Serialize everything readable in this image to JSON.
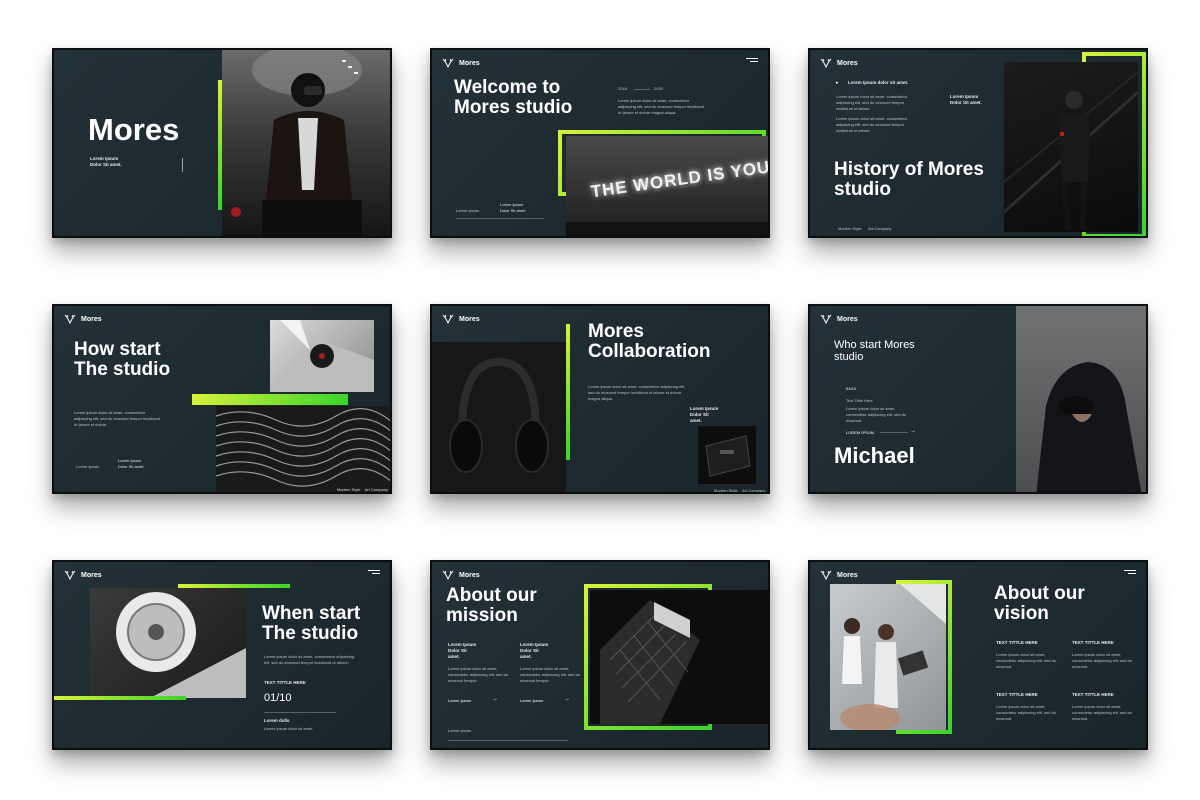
{
  "colors": {
    "accent_yellow": "#d8f23a",
    "accent_green": "#39d42a",
    "slide_bg": "#213036",
    "page_bg": "#ffffff"
  },
  "icons": {
    "brand": "deer-antler-logo-icon",
    "menu": "hamburger-menu-icon",
    "arrow": "arrow-right-icon"
  },
  "brand_name": "Mores",
  "slide1": {
    "title": "Mores",
    "sub": "Lorem Ipsum Dolor Sit amet."
  },
  "slide2": {
    "title": "Welcome to Mores studio",
    "year_start": "2018",
    "year_end": "2020",
    "body": "Lorem ipsum dolor sit amet, consectetur adipiscing elit, sed do eiusmod tempor incididunt ut labore et dolore magna aliqua.",
    "footer_left": "Lorem Ipsum",
    "footer_right": "Lorem Ipsum Dolor Sit amet.",
    "neon_sign": "THE WORLD IS YOURS"
  },
  "slide3": {
    "lead": "Lorem Ipsum dolor sit amet.",
    "body": "Lorem ipsum dolor sit amet, consectetur adipiscing elit, sed do eiusmod tempor incididunt ut labore.",
    "side_note": "Lorem Ipsum Dolor Sit amet.",
    "title": "History of Mores studio",
    "footer_left": "Modern Style",
    "footer_right": "Art Company"
  },
  "slide4": {
    "title": "How start The studio",
    "body": "Lorem ipsum dolor sit amet, consectetur adipiscing elit, sed do eiusmod tempor incididunt ut labore et dolore.",
    "footer_left": "Lorem Ipsum",
    "footer_right": "Lorem Ipsum Dolor Sit amet.",
    "caption": "Modern Style    Art Company"
  },
  "slide5": {
    "title": "Mores Collaboration",
    "body": "Lorem ipsum dolor sit amet, consectetur adipiscing elit, sed do eiusmod tempor incididunt ut labore et dolore magna aliqua.",
    "note": "Lorem Ipsum Dolor Sit amet.",
    "footer_left": "Modern Style",
    "footer_right": "Art Company"
  },
  "slide6": {
    "title": "Who start Mores studio",
    "counter": "01/10",
    "label": "Text Tittle Here",
    "body": "Lorem ipsum dolor sit amet, consectetur adipiscing elit, sed do eiusmod.",
    "link": "LOREM IPSUM",
    "name": "Michael"
  },
  "slide7": {
    "title": "When start The studio",
    "body": "Lorem ipsum dolor sit amet, consectetur adipiscing elit, sed do eiusmod tempor incididunt ut labore.",
    "label": "TEXT TITTLE HERE",
    "counter": "01/10",
    "footer_title": "Lorem dulls",
    "footer_body": "Lorem ipsum dolor sit amet."
  },
  "slide8": {
    "title": "About our mission",
    "col_a": "Lorem Ipsum Dolor Sit amet.",
    "col_b": "Lorem Ipsum Dolor Sit amet.",
    "body": "Lorem ipsum dolor sit amet, consectetur adipiscing elit, sed do eiusmod tempor.",
    "link_a": "Lorem Ipsum",
    "link_b": "Lorem Ipsum",
    "footer": "Lorem Ipsum"
  },
  "slide9": {
    "title": "About our vision",
    "items": [
      {
        "label": "TEXT TITTLE HERE",
        "body": "Lorem ipsum dolor sit amet, consectetur adipiscing elit, sed do eiusmod."
      },
      {
        "label": "TEXT TITTLE HERE",
        "body": "Lorem ipsum dolor sit amet, consectetur adipiscing elit, sed do eiusmod."
      },
      {
        "label": "TEXT TITTLE HERE",
        "body": "Lorem ipsum dolor sit amet, consectetur adipiscing elit, sed do eiusmod."
      },
      {
        "label": "TEXT TITTLE HERE",
        "body": "Lorem ipsum dolor sit amet, consectetur adipiscing elit, sed do eiusmod."
      }
    ]
  }
}
